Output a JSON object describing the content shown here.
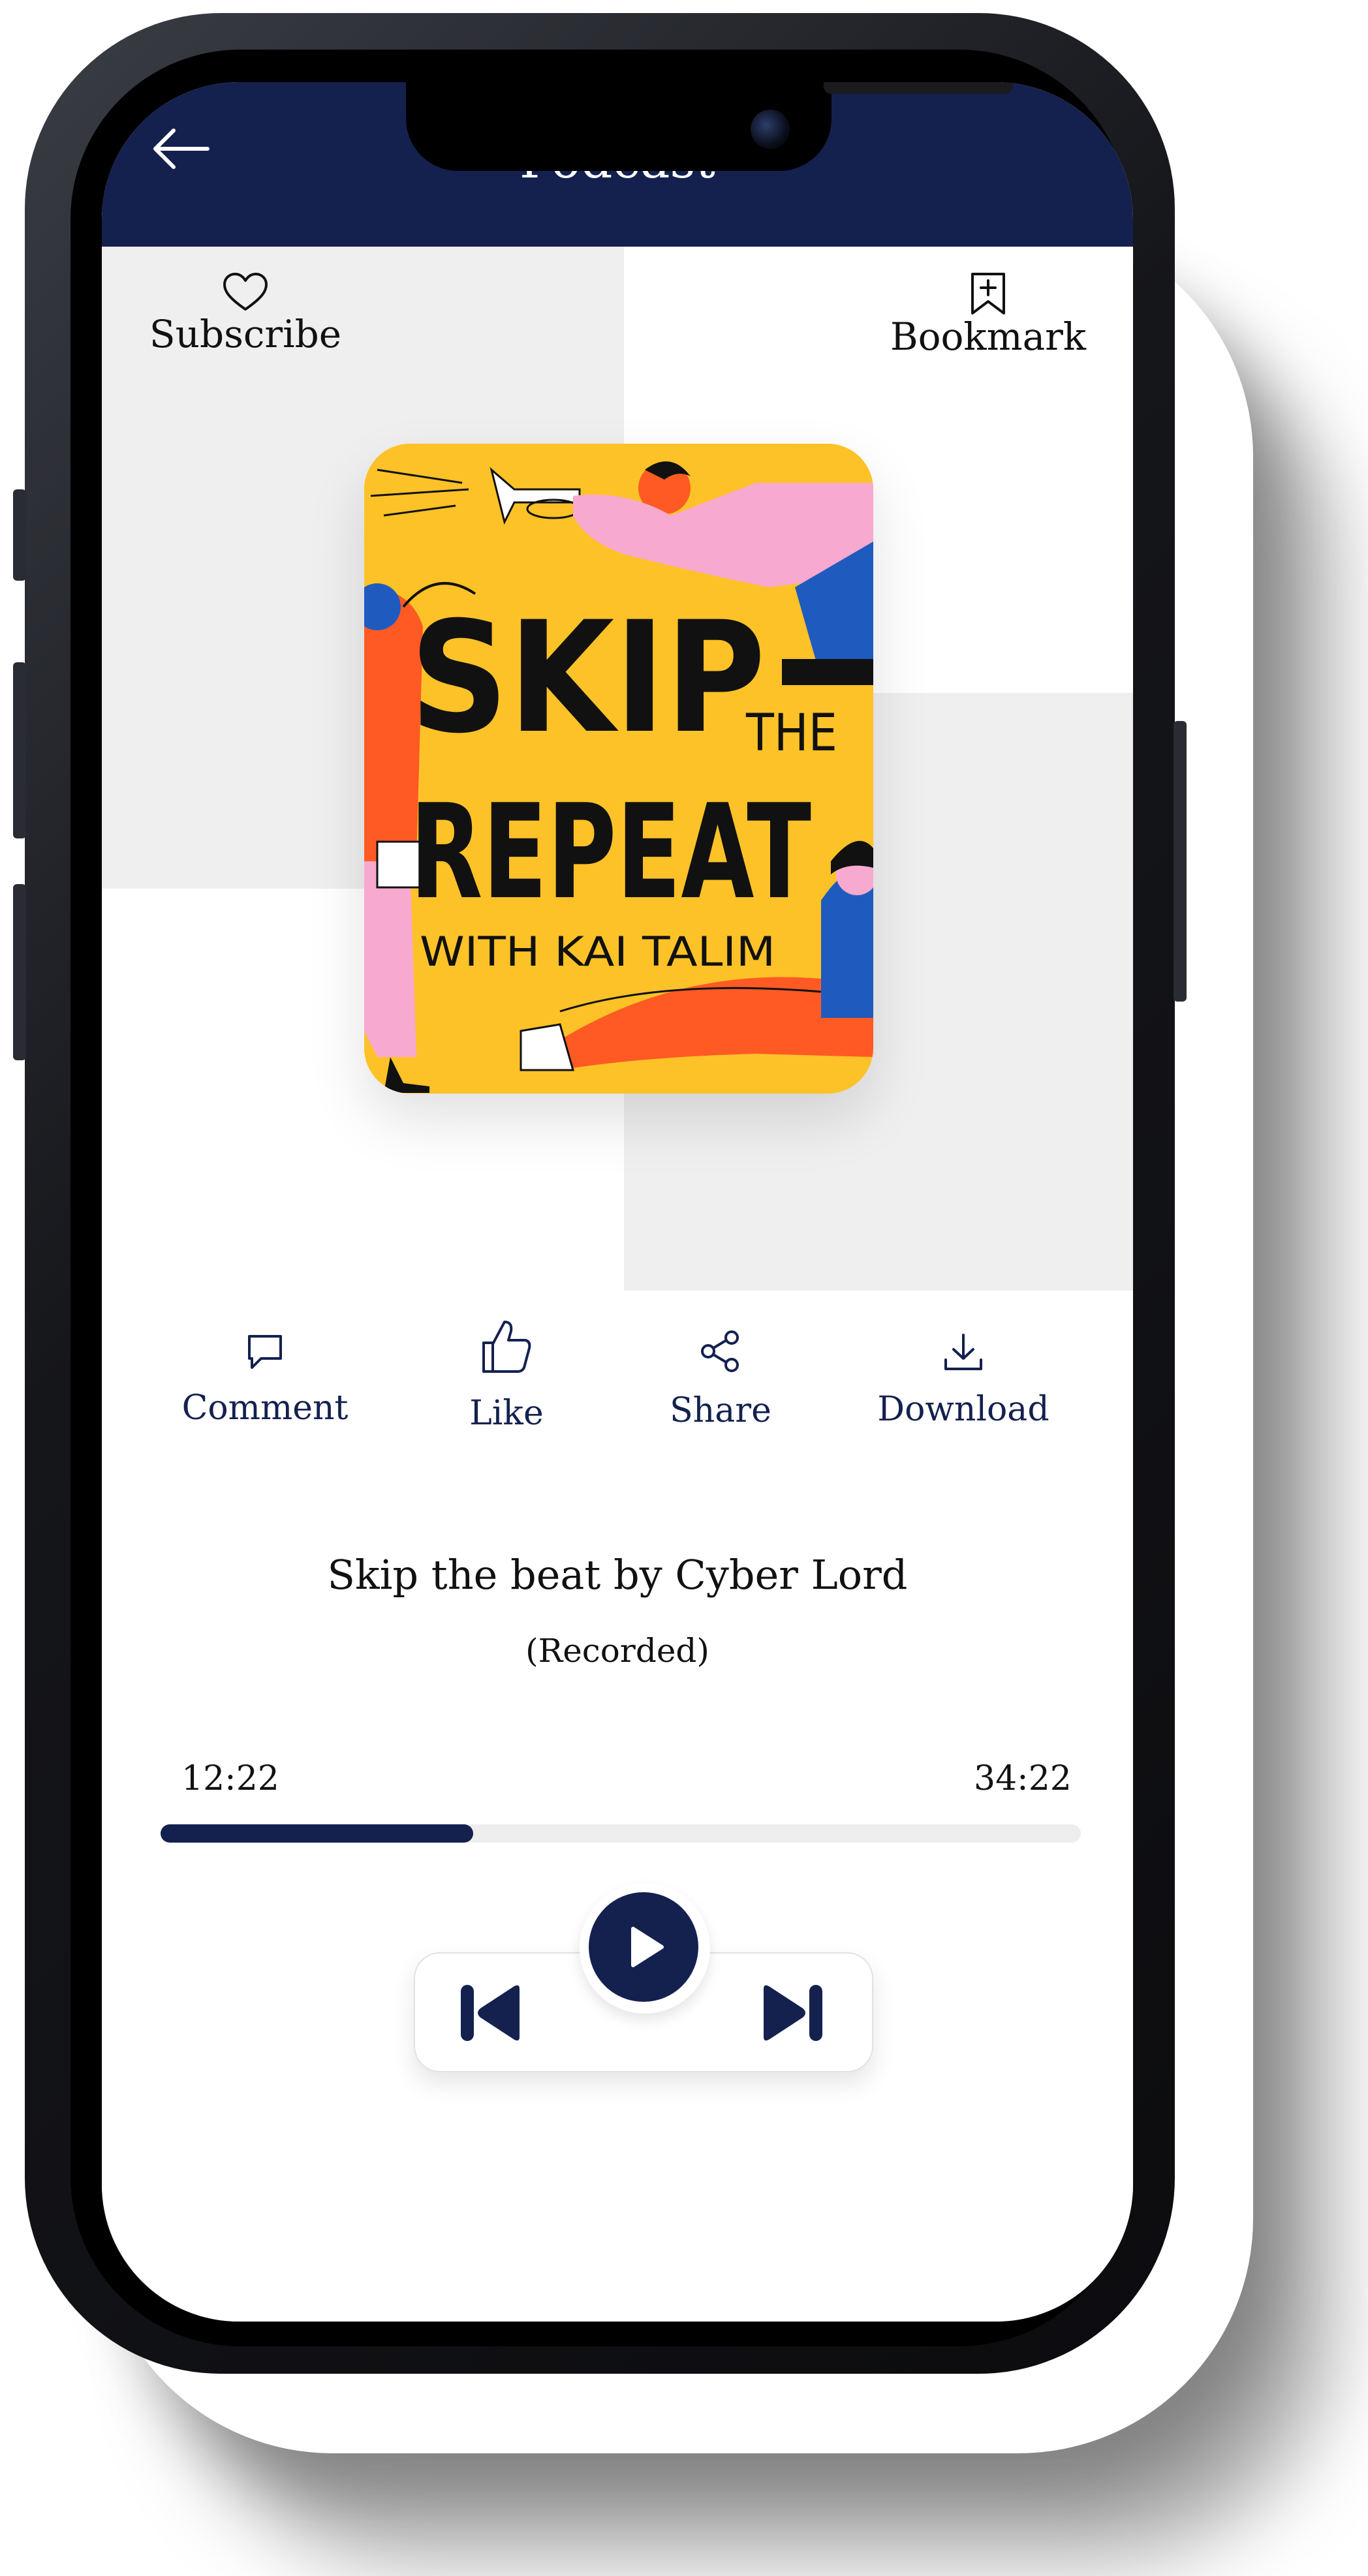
{
  "header": {
    "title": "Podcast"
  },
  "top_actions": {
    "subscribe": {
      "label": "Subscribe",
      "icon": "heart-icon"
    },
    "bookmark": {
      "label": "Bookmark",
      "icon": "bookmark-add-icon"
    }
  },
  "artwork": {
    "title_line1": "SKIP",
    "title_the": "THE",
    "title_line2": "REPEAT",
    "subtitle": "WITH KAI TALIM"
  },
  "actions": [
    {
      "label": "Comment",
      "icon": "comment-icon"
    },
    {
      "label": "Like",
      "icon": "thumbs-up-icon"
    },
    {
      "label": "Share",
      "icon": "share-icon"
    },
    {
      "label": "Download",
      "icon": "download-icon"
    }
  ],
  "track": {
    "title": "Skip the beat by Cyber Lord",
    "subtitle": "(Recorded)",
    "elapsed": "12:22",
    "duration": "34:22",
    "progress": 0.34
  },
  "controls": {
    "previous": "skip-previous-icon",
    "play": "play-icon",
    "next": "skip-next-icon"
  },
  "colors": {
    "navy": "#14214f",
    "artwork_yellow": "#fdc227",
    "accent_orange": "#ff5a24",
    "accent_pink": "#f7a9cf",
    "accent_blue": "#1f5bbf"
  }
}
